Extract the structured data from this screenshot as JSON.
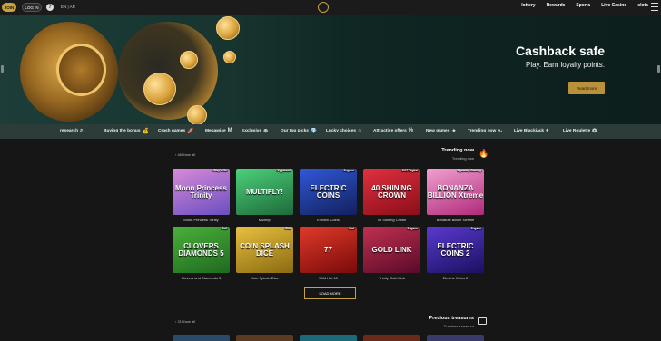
{
  "topbar": {
    "join": "JOIN",
    "login": "LOG IN",
    "help_icon": "?",
    "lang": "EN | AR",
    "nav": [
      "lottery",
      "Rewards",
      "Sports",
      "Live Casino",
      "slots"
    ],
    "menu_icon": "hamburger-icon"
  },
  "hero": {
    "title": "Cashback safe",
    "subtitle": "Play. Earn loyalty points.",
    "button": "Read more"
  },
  "categories": [
    {
      "label": "research",
      "icon": "⌕"
    },
    {
      "label": "Buying the bonus",
      "icon": "💰"
    },
    {
      "label": "Crash games",
      "icon": "🚀"
    },
    {
      "label": "Megawise",
      "icon": "M"
    },
    {
      "label": "Exclusive",
      "icon": "⊛"
    },
    {
      "label": "Our top picks",
      "icon": "💎"
    },
    {
      "label": "Lucky choices",
      "icon": "∩"
    },
    {
      "label": "Attractive offers",
      "icon": "%"
    },
    {
      "label": "New games",
      "icon": "✦"
    },
    {
      "label": "Trending now",
      "icon": "∿"
    },
    {
      "label": "Live Blackjack",
      "icon": "♠"
    },
    {
      "label": "Live Roulette",
      "icon": "❂"
    }
  ],
  "trending": {
    "show_all": "‹  46Show all",
    "title": "Trending now",
    "subtitle": "Trending now",
    "games": [
      {
        "name": "Moon Princess Trinity",
        "badge": "Play'n Go",
        "thumb_text": "Moon Princess Trinity",
        "color1": "#6a4fc0",
        "color2": "#d88ad8"
      },
      {
        "name": "Multifly!",
        "badge": "Yggdrasil",
        "thumb_text": "MULTIFLY!",
        "color1": "#1d6a3a",
        "color2": "#4dd07a"
      },
      {
        "name": "Electric Coins",
        "badge": "Fugaso",
        "thumb_text": "ELECTRIC COINS",
        "color1": "#12205c",
        "color2": "#3058d8"
      },
      {
        "name": "40 Shining Crown",
        "badge": "EGT Digital",
        "thumb_text": "40 SHINING CROWN",
        "color1": "#8a0e18",
        "color2": "#e03040"
      },
      {
        "name": "Bonanza Billion Xtreme",
        "badge": "Bgaming Gaming",
        "thumb_text": "BONANZA BILLION Xtreme",
        "color1": "#b02a7a",
        "color2": "#f0a0d0"
      }
    ]
  },
  "row2": {
    "games": [
      {
        "name": "Clovers and Diamonds 5",
        "badge": "Fed",
        "thumb_text": "CLOVERS DIAMONDS 5",
        "color1": "#1f6a1f",
        "color2": "#4ab03a"
      },
      {
        "name": "Coin Splash Dice",
        "badge": "Fed",
        "thumb_text": "COIN SPLASH DICE",
        "color1": "#8a6a10",
        "color2": "#e8c040"
      },
      {
        "name": "Wild Hot 40",
        "badge": "Fed",
        "thumb_text": "77",
        "color1": "#7a0a0a",
        "color2": "#e03a2a"
      },
      {
        "name": "Trinity Gold Link",
        "badge": "Fugaso",
        "thumb_text": "GOLD LINK",
        "color1": "#5a0a2a",
        "color2": "#c03050"
      },
      {
        "name": "Electric Coins 2",
        "badge": "Fugaso",
        "thumb_text": "ELECTRIC COINS 2",
        "color1": "#1a1060",
        "color2": "#5a3ad0"
      }
    ],
    "load_more": "LOAD MORE"
  },
  "precious": {
    "show_all": "‹  21Show all",
    "title": "Precious treasures",
    "subtitle": "Precious treasures"
  }
}
